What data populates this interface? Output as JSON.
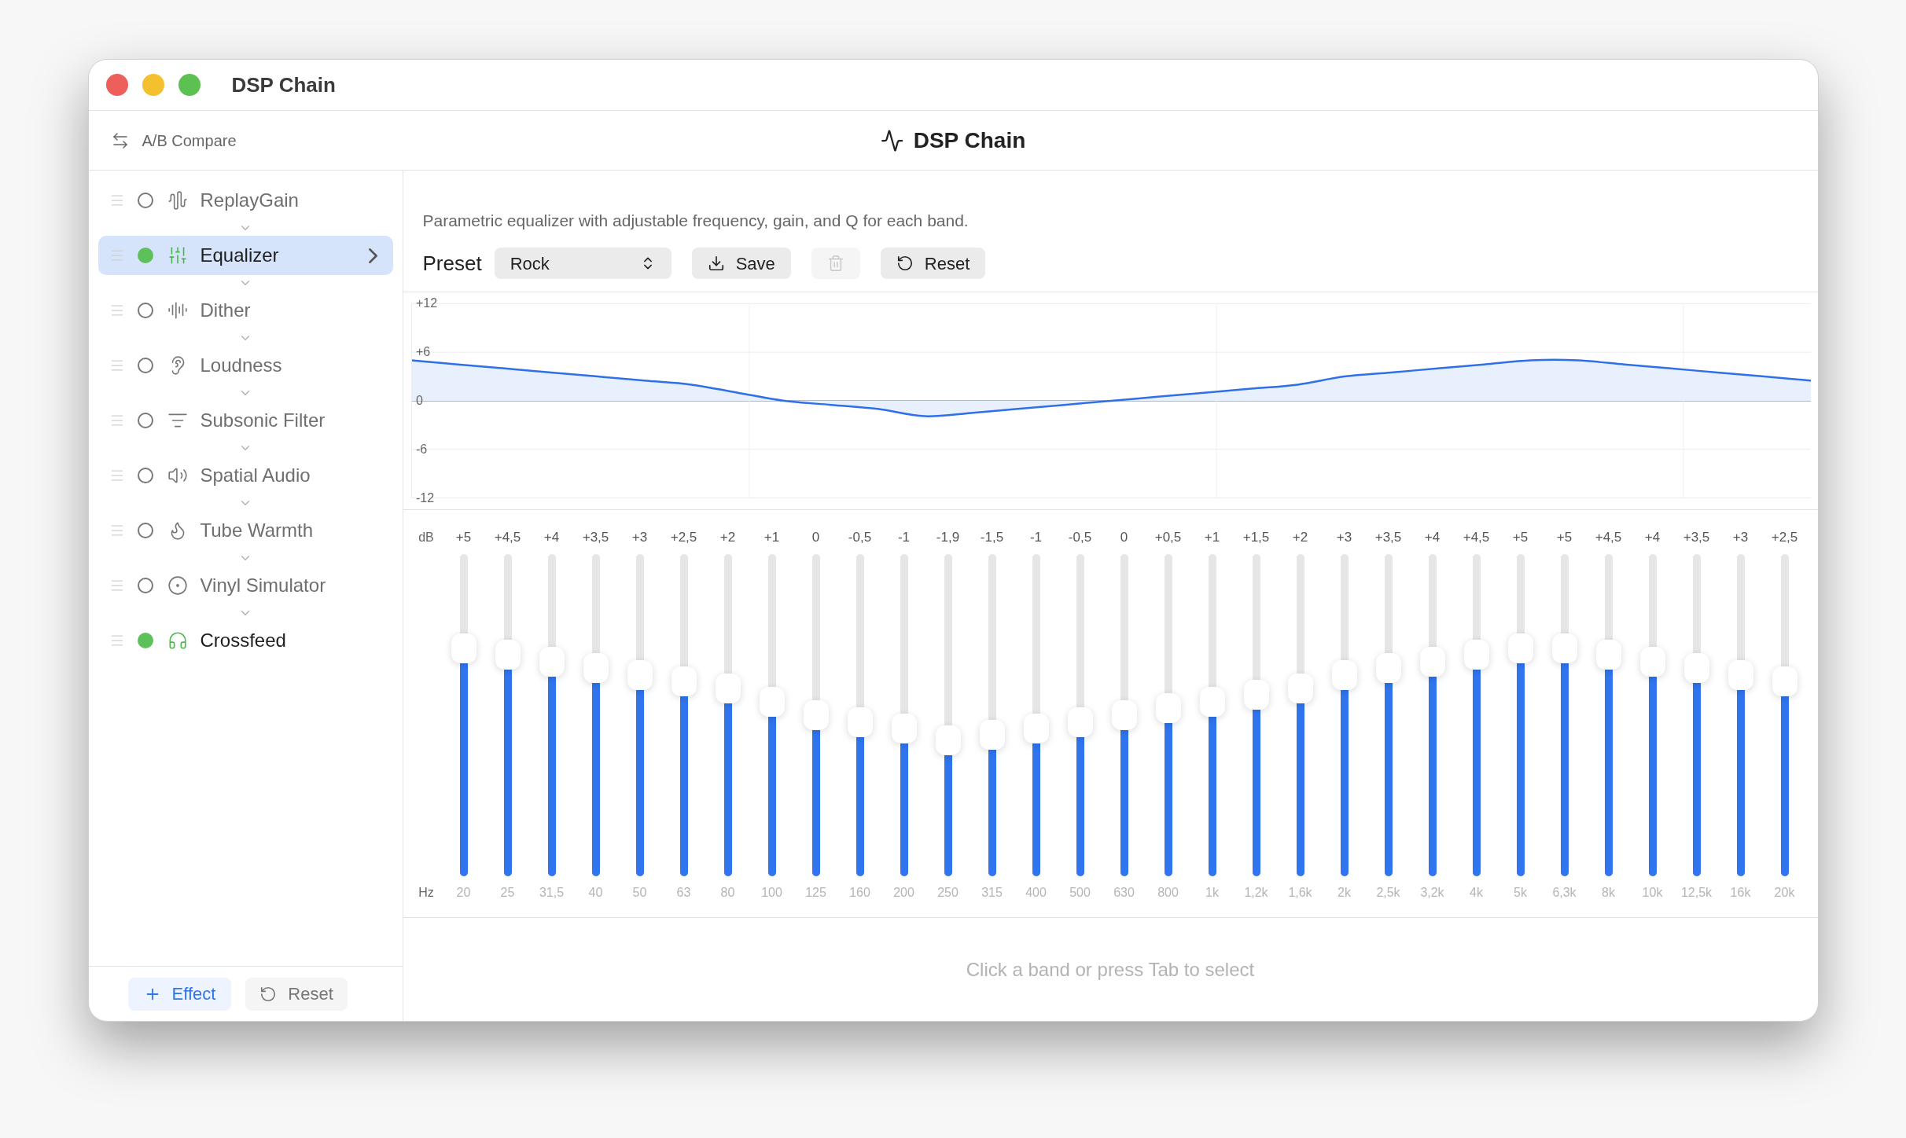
{
  "window": {
    "title": "DSP Chain"
  },
  "toolbar": {
    "compare_button": "A/B Compare",
    "title": "DSP Chain"
  },
  "sidebar": {
    "effects": [
      {
        "name": "ReplayGain",
        "enabled": false,
        "selected": false
      },
      {
        "name": "Equalizer",
        "enabled": true,
        "selected": true
      },
      {
        "name": "Dither",
        "enabled": false,
        "selected": false
      },
      {
        "name": "Loudness",
        "enabled": false,
        "selected": false
      },
      {
        "name": "Subsonic Filter",
        "enabled": false,
        "selected": false
      },
      {
        "name": "Spatial Audio",
        "enabled": false,
        "selected": false
      },
      {
        "name": "Tube Warmth",
        "enabled": false,
        "selected": false
      },
      {
        "name": "Vinyl Simulator",
        "enabled": false,
        "selected": false
      },
      {
        "name": "Crossfeed",
        "enabled": true,
        "selected": false
      }
    ],
    "buttons": [
      {
        "label": "Effect",
        "kind": "add"
      },
      {
        "label": "Reset",
        "kind": "reset"
      }
    ]
  },
  "equalizer": {
    "description": "Parametric equalizer with adjustable frequency, gain, and Q for each band.",
    "preset_label": "Preset",
    "preset": {
      "value": "Rock"
    },
    "buttons": [
      {
        "label": "Save",
        "kind": "save",
        "disabled": false
      },
      {
        "kind": "delete",
        "disabled": true
      },
      {
        "label": "Reset",
        "kind": "reset",
        "disabled": false
      }
    ],
    "response_curve": {
      "chart_data": {
        "type": "line",
        "ylim": [
          -12,
          12
        ],
        "yticks": [
          {
            "value": 12,
            "label": "+12"
          },
          {
            "value": 6,
            "label": "+6"
          },
          {
            "value": 0,
            "label": "0"
          },
          {
            "value": -6,
            "label": "-6"
          },
          {
            "value": -12,
            "label": "-12"
          }
        ],
        "series": [
          {
            "color": "#2f6fe8",
            "values": [
              5,
              4.5,
              4,
              3.5,
              3,
              2.5,
              2,
              1,
              0,
              -0.5,
              -1,
              -1.9,
              -1.5,
              -1,
              -0.5,
              0,
              0.5,
              1,
              1.5,
              2,
              3,
              3.5,
              4,
              4.5,
              5,
              5,
              4.5,
              4,
              3.5,
              3,
              2.5
            ]
          }
        ]
      }
    },
    "gain_unit": "dB",
    "freq_unit": "Hz",
    "bands": [
      {
        "gain": "+5",
        "freq": "20",
        "level": 0.708
      },
      {
        "gain": "+4,5",
        "freq": "25",
        "level": 0.688
      },
      {
        "gain": "+4",
        "freq": "31,5",
        "level": 0.667
      },
      {
        "gain": "+3,5",
        "freq": "40",
        "level": 0.646
      },
      {
        "gain": "+3",
        "freq": "50",
        "level": 0.625
      },
      {
        "gain": "+2,5",
        "freq": "63",
        "level": 0.604
      },
      {
        "gain": "+2",
        "freq": "80",
        "level": 0.583
      },
      {
        "gain": "+1",
        "freq": "100",
        "level": 0.542
      },
      {
        "gain": "0",
        "freq": "125",
        "level": 0.5
      },
      {
        "gain": "-0,5",
        "freq": "160",
        "level": 0.479
      },
      {
        "gain": "-1",
        "freq": "200",
        "level": 0.458
      },
      {
        "gain": "-1,9",
        "freq": "250",
        "level": 0.421
      },
      {
        "gain": "-1,5",
        "freq": "315",
        "level": 0.438
      },
      {
        "gain": "-1",
        "freq": "400",
        "level": 0.458
      },
      {
        "gain": "-0,5",
        "freq": "500",
        "level": 0.479
      },
      {
        "gain": "0",
        "freq": "630",
        "level": 0.5
      },
      {
        "gain": "+0,5",
        "freq": "800",
        "level": 0.521
      },
      {
        "gain": "+1",
        "freq": "1k",
        "level": 0.542
      },
      {
        "gain": "+1,5",
        "freq": "1,2k",
        "level": 0.563
      },
      {
        "gain": "+2",
        "freq": "1,6k",
        "level": 0.583
      },
      {
        "gain": "+3",
        "freq": "2k",
        "level": 0.625
      },
      {
        "gain": "+3,5",
        "freq": "2,5k",
        "level": 0.646
      },
      {
        "gain": "+4",
        "freq": "3,2k",
        "level": 0.667
      },
      {
        "gain": "+4,5",
        "freq": "4k",
        "level": 0.688
      },
      {
        "gain": "+5",
        "freq": "5k",
        "level": 0.708
      },
      {
        "gain": "+5",
        "freq": "6,3k",
        "level": 0.708
      },
      {
        "gain": "+4,5",
        "freq": "8k",
        "level": 0.688
      },
      {
        "gain": "+4",
        "freq": "10k",
        "level": 0.667
      },
      {
        "gain": "+3,5",
        "freq": "12,5k",
        "level": 0.646
      },
      {
        "gain": "+3",
        "freq": "16k",
        "level": 0.625
      },
      {
        "gain": "+2,5",
        "freq": "20k",
        "level": 0.604
      }
    ],
    "hint": "Click a band or press Tab to select"
  }
}
